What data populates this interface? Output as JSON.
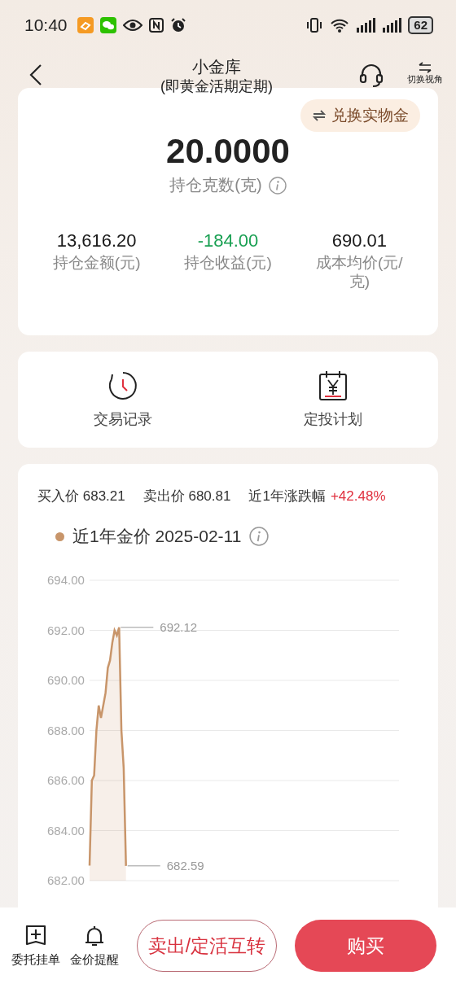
{
  "status_bar": {
    "time": "10:40",
    "battery": "62"
  },
  "header": {
    "title": "小金库",
    "subtitle": "(即黄金活期定期)",
    "switch_label": "切换视角"
  },
  "holdings": {
    "exchange_button": "兑换实物金",
    "grams": "20.0000",
    "grams_label": "持仓克数(克)",
    "stats": [
      {
        "value": "13,616.20",
        "label": "持仓金额(元)",
        "color": "#1a1a1a"
      },
      {
        "value": "-184.00",
        "label": "持仓收益(元)",
        "color": "#1aa053"
      },
      {
        "value": "690.01",
        "label": "成本均价(元/克)",
        "color": "#1a1a1a"
      }
    ]
  },
  "shortcuts": [
    {
      "label": "交易记录",
      "kind": "history"
    },
    {
      "label": "定投计划",
      "kind": "plan"
    }
  ],
  "quote": {
    "buy_label": "买入价",
    "buy": "683.21",
    "sell_label": "卖出价",
    "sell": "680.81",
    "change_label": "近1年涨跌幅",
    "change": "+42.48%",
    "date": "2025-02-11",
    "chart_data": {
      "type": "area",
      "ylim": [
        682,
        694
      ],
      "categories": [
        null,
        null,
        null,
        null,
        null,
        null,
        null,
        null,
        null,
        null,
        null,
        null,
        null,
        null,
        null,
        null,
        null,
        null,
        null,
        null,
        null,
        null,
        null,
        null,
        null,
        null,
        null,
        null,
        null,
        null,
        null,
        null,
        null,
        null,
        null,
        null,
        null,
        null,
        null,
        null,
        null,
        null,
        null,
        null,
        null,
        null,
        null,
        null,
        null,
        null,
        null,
        null,
        null,
        null,
        null,
        null,
        null,
        null,
        null,
        null,
        null,
        null,
        null,
        null,
        null,
        null,
        null,
        null,
        null,
        null,
        null,
        null,
        null,
        null,
        null,
        null,
        null,
        null,
        null,
        null,
        null,
        null,
        null,
        null,
        null,
        null,
        null,
        null,
        null,
        null,
        null,
        null,
        null,
        null,
        null,
        null,
        null,
        null,
        null,
        null,
        null,
        null,
        null,
        null,
        null,
        null,
        null,
        null,
        null,
        null,
        null,
        null,
        null,
        null,
        null,
        null,
        null,
        null,
        null,
        null,
        null,
        null,
        null,
        null,
        null,
        null,
        null,
        null,
        null,
        null,
        null,
        null,
        null,
        null,
        null,
        null,
        null
      ],
      "series": [
        {
          "name": "近1年金价",
          "color": "#c8956a",
          "values": [
            682.6,
            686,
            686.2,
            688,
            689,
            688.5,
            689,
            689.5,
            690.5,
            690.8,
            691.5,
            692,
            691.8,
            692.12,
            688,
            686.5,
            682.59,
            null,
            null,
            null,
            null,
            null,
            null,
            null,
            null,
            null,
            null,
            null,
            null,
            null,
            null,
            null,
            null,
            null,
            null,
            null,
            null,
            null,
            null,
            null,
            null,
            null,
            null,
            null,
            null,
            null,
            null,
            null,
            null,
            null,
            null,
            null,
            null,
            null,
            null,
            null,
            null,
            null,
            null,
            null,
            null,
            null,
            null,
            null,
            null,
            null,
            null,
            null,
            null,
            null,
            null,
            null,
            null,
            null,
            null,
            null,
            null,
            null,
            null,
            null,
            null,
            null,
            null,
            null,
            null,
            null,
            null,
            null,
            null,
            null,
            null,
            null,
            null,
            null,
            null,
            null,
            null,
            null,
            null,
            null,
            null,
            null,
            null,
            null,
            null,
            null,
            null,
            null,
            null,
            null,
            null,
            null,
            null,
            null,
            null,
            null,
            null,
            null,
            null,
            null,
            null,
            null,
            null,
            null,
            null,
            null,
            null,
            null,
            null,
            null,
            null,
            null,
            null,
            null,
            null,
            null,
            null
          ]
        }
      ],
      "yticks": [
        {
          "value": 682,
          "label": "682.00"
        },
        {
          "value": 684,
          "label": "684.00"
        },
        {
          "value": 686,
          "label": "686.00"
        },
        {
          "value": 688,
          "label": "688.00"
        },
        {
          "value": 690,
          "label": "690.00"
        },
        {
          "value": 692,
          "label": "692.00"
        },
        {
          "value": 694,
          "label": "694.00"
        }
      ],
      "grid": true,
      "annotations": [
        "692.12",
        "682.59"
      ]
    }
  },
  "footer": {
    "actions": [
      {
        "label": "委托挂单",
        "kind": "order"
      },
      {
        "label": "金价提醒",
        "kind": "alert"
      }
    ],
    "sell_button": "卖出/定活互转",
    "buy_button": "购买"
  }
}
